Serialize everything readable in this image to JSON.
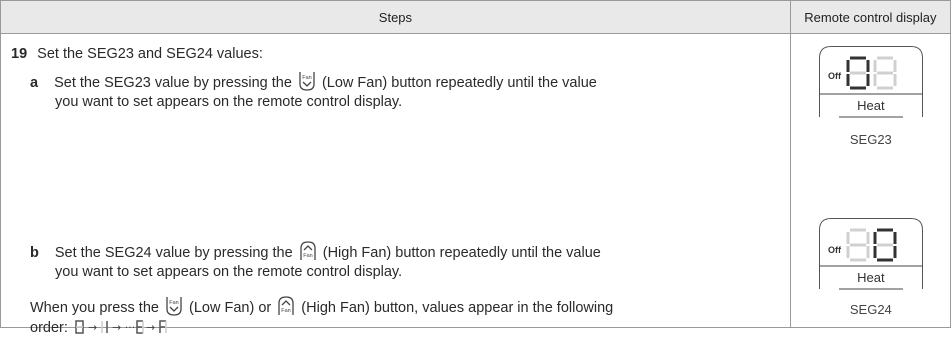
{
  "header": {
    "steps": "Steps",
    "display": "Remote control display"
  },
  "step": {
    "number": "19",
    "intro": "Set the SEG23 and SEG24 values:",
    "a": {
      "letter": "a",
      "line1_pre": "Set the SEG23 value by pressing the",
      "line1_post": "(Low Fan) button repeatedly until the value",
      "line2": "you want to set appears on the remote control display."
    },
    "b": {
      "letter": "b",
      "line1_pre": "Set the SEG24 value by pressing the",
      "line1_post": "(High Fan) button repeatedly until the value",
      "line2": "you want to set appears on the remote control display."
    },
    "note": {
      "pre": "When you press the",
      "mid": "(Low Fan) or",
      "post": "(High Fan) button, values appear in the following",
      "order_label": "order:"
    }
  },
  "icons": {
    "low_fan_label": "Fan",
    "high_fan_label": "Fan"
  },
  "displays": [
    {
      "off": "Off",
      "mode": "Heat",
      "caption": "SEG23"
    },
    {
      "off": "Off",
      "mode": "Heat",
      "caption": "SEG24"
    }
  ]
}
